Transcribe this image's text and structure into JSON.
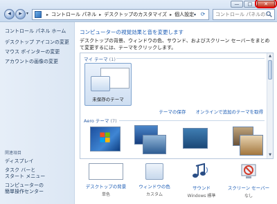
{
  "window": {
    "caption": {
      "minimize": "—",
      "maximize": "□",
      "close": "✕"
    }
  },
  "address": {
    "segments": [
      "コントロール パネル",
      "デスクトップのカスタマイズ",
      "個人設定"
    ],
    "separator": "▸"
  },
  "search": {
    "placeholder": "コントロール パネルの..."
  },
  "leftpane": {
    "home": "コントロール パネル ホーム",
    "links": [
      "デスクトップ アイコンの変更",
      "マウス ポインターの変更",
      "アカウントの画像の変更"
    ],
    "related_header": "関連項目",
    "related": [
      "ディスプレイ",
      "タスク バーと\nスタート メニュー",
      "コンピューターの\n簡単操作センター"
    ]
  },
  "main": {
    "title": "コンピューターの視覚効果と音を変更します",
    "description": "デスクトップの背景、ウィンドウの色、サウンド、およびスクリーン セーバーをまとめて変更するには、テーマをクリックします。",
    "my_themes_label": "マイ テーマ",
    "my_themes_count": "(1)",
    "unsaved_theme": "未保存のテーマ",
    "save_theme": "テーマの保存",
    "get_more_themes": "オンラインで追加のテーマを取得",
    "aero_label": "Aero テーマ",
    "aero_count": "(7)"
  },
  "settings": [
    {
      "label": "デスクトップの背景",
      "value": "単色",
      "icon": "desktop-background-icon"
    },
    {
      "label": "ウィンドウの色",
      "value": "カスタム",
      "icon": "window-color-icon"
    },
    {
      "label": "サウンド",
      "value": "Windows 標準",
      "icon": "sound-icon"
    },
    {
      "label": "スクリーン セーバー",
      "value": "なし",
      "icon": "screen-saver-icon"
    }
  ],
  "colors": {
    "link": "#1a5bb4",
    "close_highlight": "#e00000",
    "aero_thumbs": [
      "#2a63b8",
      "#1e5aa8",
      "#3d6e9c",
      "#7a6a55",
      "#b58e61"
    ]
  }
}
